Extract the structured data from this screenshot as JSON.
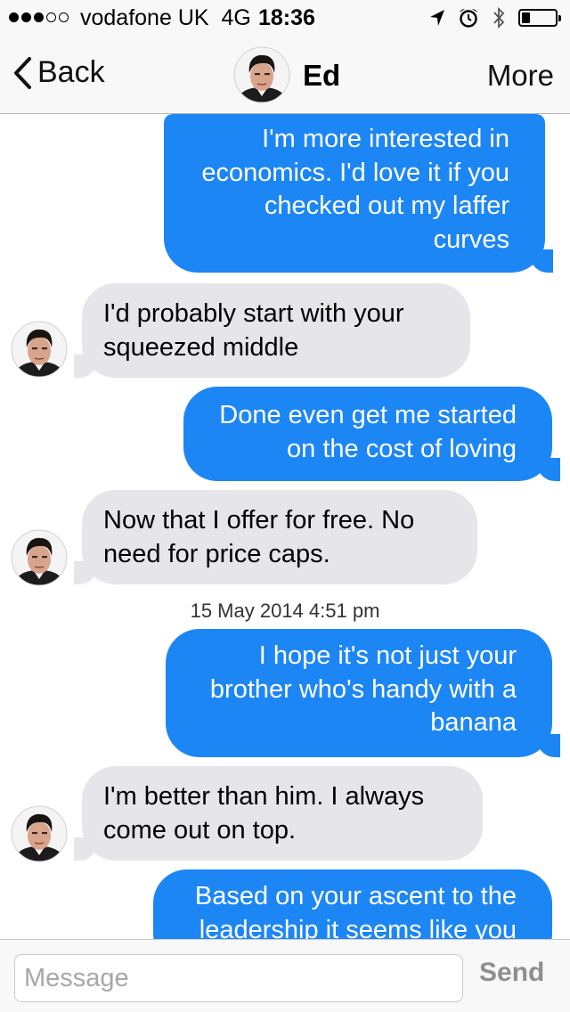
{
  "status_bar": {
    "signal": {
      "filled": 3,
      "total": 5
    },
    "carrier": "vodafone UK",
    "network": "4G",
    "time": "18:36",
    "battery_level": 0.25,
    "icons": [
      "location-arrow-icon",
      "alarm-icon",
      "bluetooth-icon",
      "battery-icon"
    ]
  },
  "nav": {
    "back_label": "Back",
    "contact_name": "Ed",
    "more_label": "More"
  },
  "messages": [
    {
      "direction": "outgoing",
      "lines": [
        "I'm more interested in",
        "economics. I'd love it if you",
        "checked out my laffer",
        "curves"
      ]
    },
    {
      "direction": "incoming",
      "lines": [
        "I'd probably start with your",
        "squeezed middle"
      ]
    },
    {
      "direction": "outgoing",
      "lines": [
        "Done even get me started",
        "on the cost of loving"
      ]
    },
    {
      "direction": "incoming",
      "lines": [
        "Now that I offer for free. No",
        "need for price caps."
      ]
    },
    {
      "type": "timestamp",
      "text": "15 May 2014 4:51 pm"
    },
    {
      "direction": "outgoing",
      "lines": [
        "I hope it's not just your",
        "brother who's handy with a",
        "banana"
      ]
    },
    {
      "direction": "incoming",
      "lines": [
        "I'm better than him. I always",
        "come out on top."
      ]
    },
    {
      "direction": "outgoing",
      "lines": [
        "Based on your ascent to the",
        "leadership it seems like you"
      ]
    }
  ],
  "input": {
    "placeholder": "Message",
    "value": "",
    "send_label": "Send"
  },
  "colors": {
    "outgoing_bubble": "#1d86f5",
    "incoming_bubble": "#e5e5ea",
    "bar_background": "#f8f8f8",
    "send_disabled": "#8e8e93"
  }
}
